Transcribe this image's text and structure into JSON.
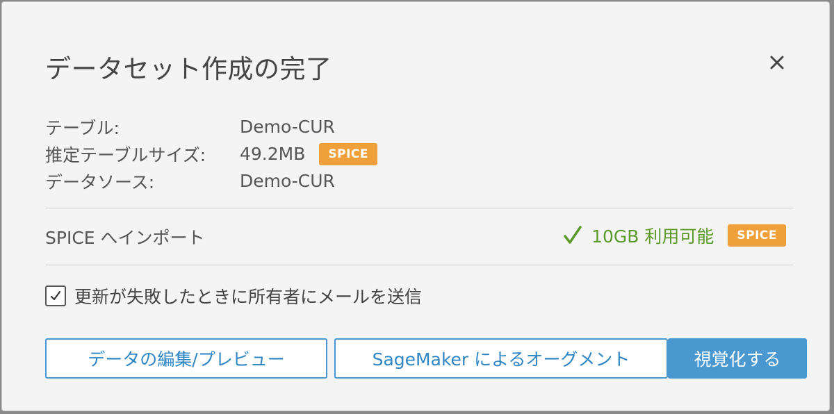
{
  "dialog": {
    "title": "データセット作成の完了",
    "close_icon": "close-icon"
  },
  "info": {
    "rows": [
      {
        "label": "テーブル:",
        "value": "Demo-CUR"
      },
      {
        "label": "推定テーブルサイズ:",
        "value": "49.2MB",
        "badge": "SPICE"
      },
      {
        "label": "データソース:",
        "value": "Demo-CUR"
      }
    ]
  },
  "spice_import": {
    "label": "SPICE へインポート",
    "capacity": "10GB 利用可能",
    "badge": "SPICE",
    "check_icon": "check-icon"
  },
  "notify": {
    "checked": true,
    "label": "更新が失敗したときに所有者にメールを送信"
  },
  "buttons": {
    "edit_preview": "データの編集/プレビュー",
    "sagemaker": "SageMaker によるオーグメント",
    "visualize": "視覚化する"
  },
  "colors": {
    "badge": "#f0a03a",
    "accent": "#4a98cf",
    "success": "#5b9a2a"
  }
}
